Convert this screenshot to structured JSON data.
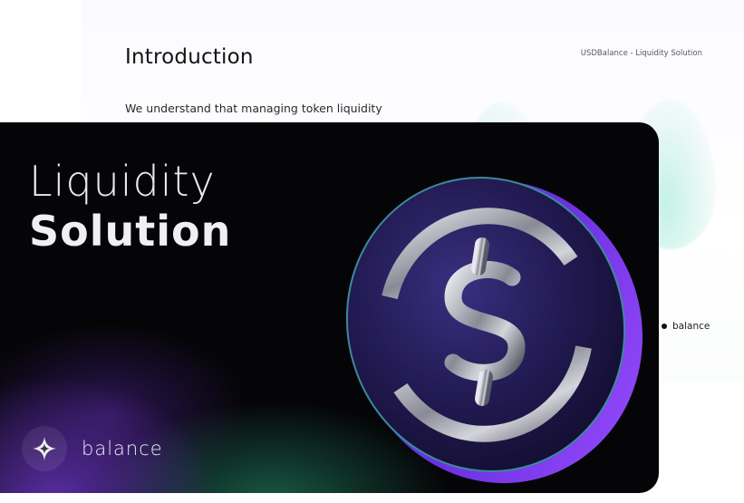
{
  "back_slide": {
    "title": "Introduction",
    "header": "USDBalance - Liquidity Solution",
    "body": "We understand that managing token liquidity",
    "brand": "balance"
  },
  "front_card": {
    "title_line1": "Liquidity",
    "title_line2": "Solution",
    "brand": "balance"
  },
  "colors": {
    "accent_purple": "#7a3cf0",
    "accent_green": "#2ea07a",
    "dark_bg": "#050507"
  },
  "icons": [
    "balance-logo-icon",
    "usdc-coin-icon"
  ]
}
